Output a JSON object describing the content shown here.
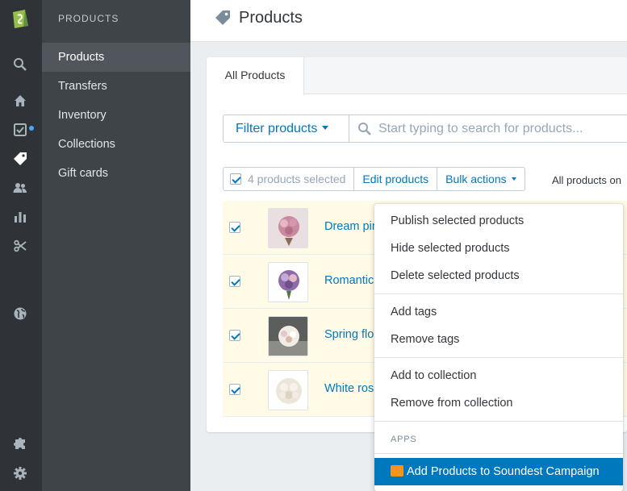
{
  "sidebar": {
    "section_title": "PRODUCTS",
    "items": [
      {
        "label": "Products"
      },
      {
        "label": "Transfers"
      },
      {
        "label": "Inventory"
      },
      {
        "label": "Collections"
      },
      {
        "label": "Gift cards"
      }
    ],
    "rail_icons": [
      "shopify-logo-icon",
      "search-icon",
      "home-icon",
      "orders-icon",
      "products-tag-icon",
      "customers-icon",
      "reports-icon",
      "discounts-icon",
      "online-store-icon",
      "apps-icon",
      "settings-icon"
    ]
  },
  "header": {
    "title": "Products"
  },
  "tabs": [
    {
      "label": "All Products"
    }
  ],
  "filter": {
    "label": "Filter products"
  },
  "search": {
    "placeholder": "Start typing to search for products..."
  },
  "bulk": {
    "selected": "4 products selected",
    "edit": "Edit products",
    "actions": "Bulk actions",
    "all_products_on": "All products on"
  },
  "rows": [
    {
      "name": "Dream pink"
    },
    {
      "name": "Romantic"
    },
    {
      "name": "Spring flo"
    },
    {
      "name": "White ros"
    }
  ],
  "menu": {
    "items": [
      "Publish selected products",
      "Hide selected products",
      "Delete selected products",
      "Add tags",
      "Remove tags",
      "Add to collection",
      "Remove from collection"
    ],
    "apps_header": "APPS",
    "app_item": "Add Products to Soundest Campaign"
  },
  "colors": {
    "accent": "#0078bd",
    "rail_bg": "#2f3337",
    "subnav_bg": "#3f4448",
    "selected_row_bg": "#fffbe6",
    "app_icon": "#f7941d"
  }
}
